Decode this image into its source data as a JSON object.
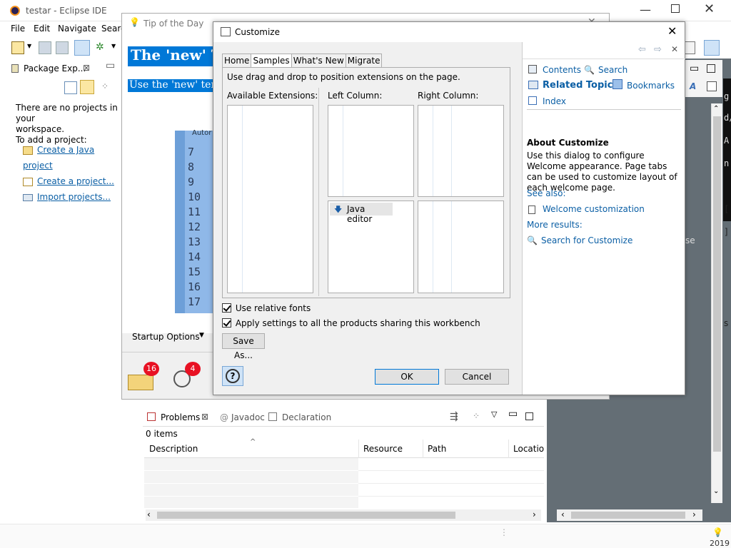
{
  "eclipse": {
    "title": "testar - Eclipse IDE",
    "menu": [
      "File",
      "Edit",
      "Navigate",
      "Searc"
    ],
    "package_explorer": {
      "title": "Package Exp...",
      "empty_line1": "There are no projects in your",
      "empty_line2": "workspace.",
      "add_line": "To add a project:",
      "links": [
        "Create a Java project",
        "Create a project...",
        "Import projects..."
      ]
    },
    "right_fragments": {
      "g": "g:",
      "d": "d/",
      "a": "A",
      "n": "n!",
      "b": "[",
      "e": "]",
      "se": "se",
      "s": "s",
      "year": "2019"
    },
    "problems": {
      "tabs": [
        "Problems",
        "Javadoc",
        "Declaration"
      ],
      "count": "0 items",
      "columns": [
        "Description",
        "Resource",
        "Path",
        "Locatio"
      ]
    }
  },
  "tip": {
    "title": "Tip of the Day",
    "heading": "The 'new' T",
    "subtext": "Use the 'new' temp",
    "line_numbers": [
      "7",
      "8",
      "9",
      "10",
      "11",
      "12",
      "13",
      "14",
      "15",
      "16",
      "17"
    ],
    "code_header": "Autor",
    "startup_options": "Startup Options",
    "badges": [
      "16",
      "4"
    ]
  },
  "customize": {
    "title": "Customize",
    "tabs": [
      "Home",
      "Samples",
      "What's New",
      "Migrate"
    ],
    "instruction": "Use drag and drop to position extensions on the page.",
    "available_label": "Available Extensions:",
    "left_label": "Left Column:",
    "right_label": "Right Column:",
    "left_bottom_item": "Java editor",
    "use_relative_fonts": "Use relative fonts",
    "apply_all": "Apply settings to all the products sharing this workbench",
    "save_as": "Save As...",
    "ok": "OK",
    "cancel": "Cancel",
    "help": {
      "contents": "Contents",
      "search": "Search",
      "related_topics": "Related Topics",
      "bookmarks": "Bookmarks",
      "index": "Index",
      "about_title": "About Customize",
      "about_text": "Use this dialog to configure Welcome appearance. Page tabs can be used to customize layout of each welcome page.",
      "see_also": "See also:",
      "welcome_link": "Welcome customization",
      "more_results": "More results:",
      "search_for": "Search for Customize"
    }
  },
  "colors": {
    "highlight": "#0078d7",
    "link": "#0b5fa5",
    "badge": "#e81123",
    "gray_panel": "#646e75"
  }
}
